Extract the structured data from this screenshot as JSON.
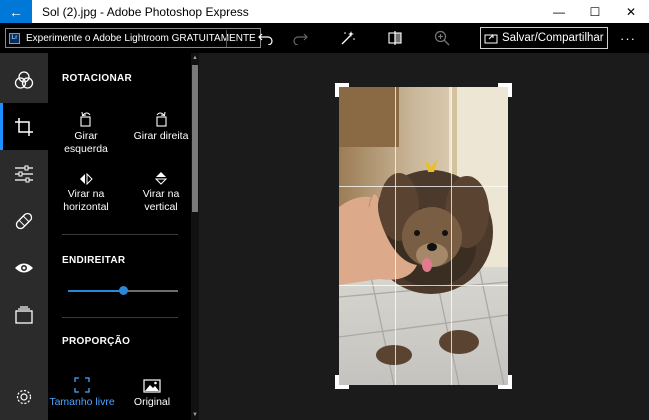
{
  "window": {
    "title": "Sol (2).jpg - Adobe Photoshop Express",
    "back_glyph": "←",
    "minimize_glyph": "—",
    "maximize_glyph": "☐",
    "close_glyph": "✕"
  },
  "toolbar": {
    "lightroom_logo": "Lr",
    "lightroom_promo": "Experimente o Adobe Lightroom GRATUITAMENTE",
    "save_label": "Salvar/Compartilhar",
    "more_glyph": "···",
    "icons": [
      "undo-icon",
      "redo-icon",
      "auto-fix-icon",
      "compare-icon",
      "zoom-icon"
    ]
  },
  "rail": {
    "items": [
      {
        "name": "looks",
        "icon": "circles-icon",
        "active": false
      },
      {
        "name": "crop",
        "icon": "crop-icon",
        "active": true
      },
      {
        "name": "adjust",
        "icon": "sliders-icon",
        "active": false
      },
      {
        "name": "heal",
        "icon": "bandage-icon",
        "active": false
      },
      {
        "name": "red-eye",
        "icon": "eye-icon",
        "active": false
      },
      {
        "name": "borders",
        "icon": "layers-icon",
        "active": false
      }
    ],
    "settings_icon": "gear-icon"
  },
  "panel": {
    "rotate": {
      "title": "ROTACIONAR",
      "rotate_left": "Girar esquerda",
      "rotate_right": "Girar direita",
      "flip_h": "Virar na horizontal",
      "flip_v": "Virar na vertical"
    },
    "straighten": {
      "title": "ENDIREITAR",
      "value": 0.5
    },
    "aspect": {
      "title": "PROPORÇÃO",
      "free": "Tamanho livre",
      "original": "Original"
    }
  },
  "colors": {
    "accent": "#2b88d8",
    "titlebar_back": "#0078d7"
  }
}
